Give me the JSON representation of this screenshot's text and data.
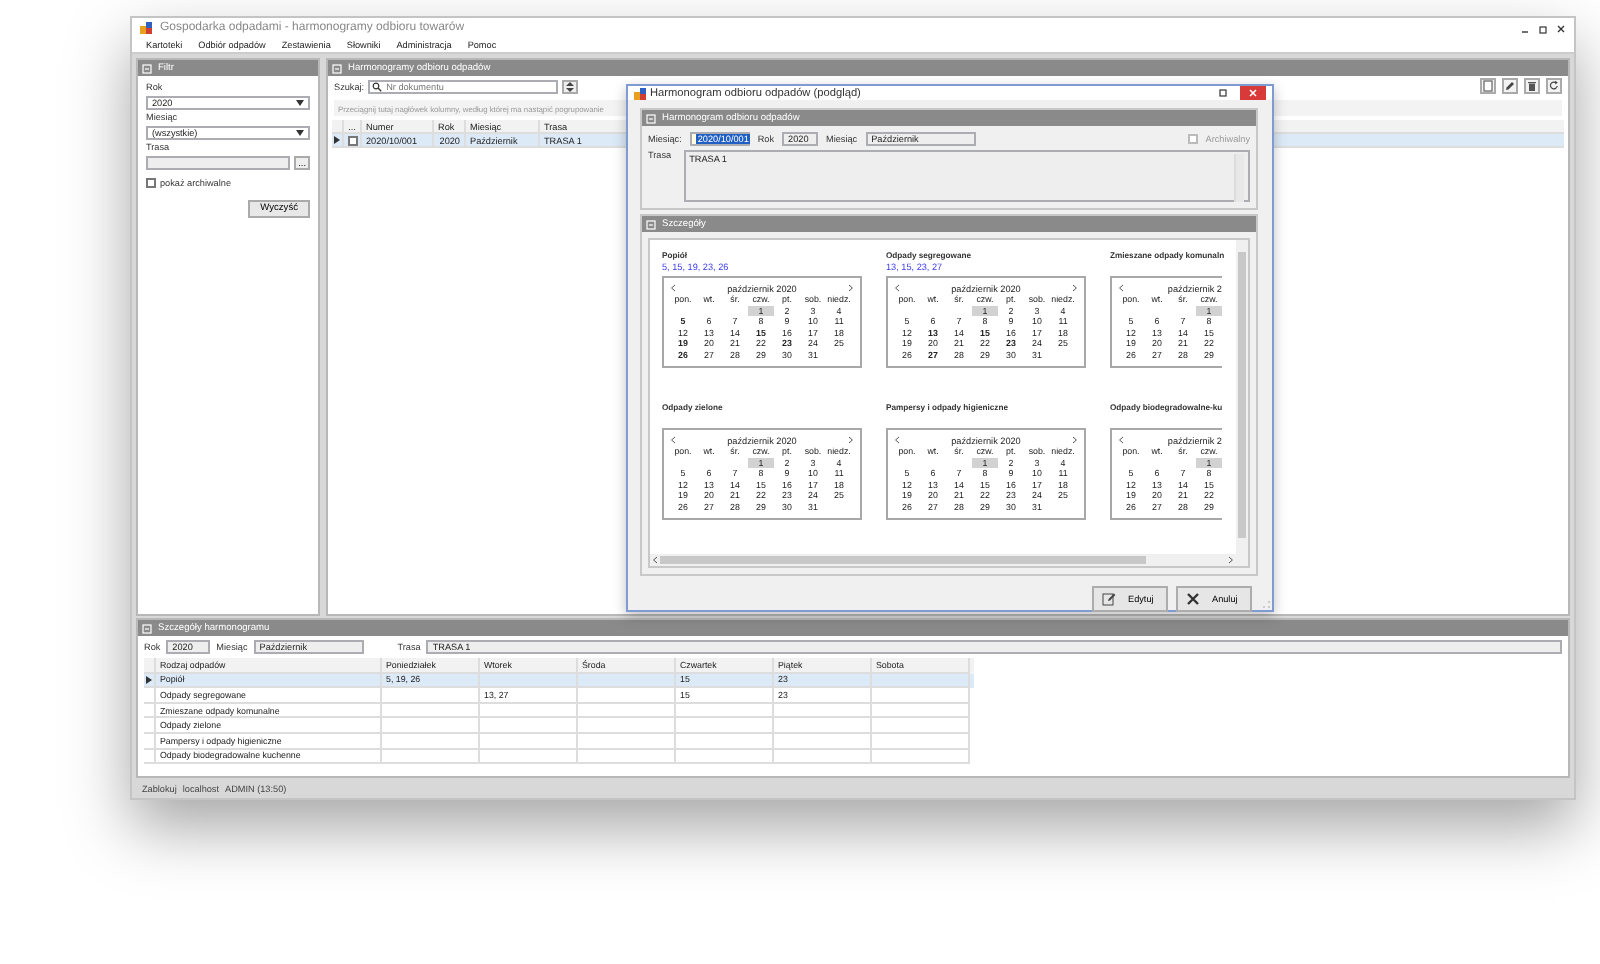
{
  "window": {
    "title": "Gospodarka odpadami - harmonogramy odbioru towarów"
  },
  "menu": [
    "Kartoteki",
    "Odbiór odpadów",
    "Zestawienia",
    "Słowniki",
    "Administracja",
    "Pomoc"
  ],
  "filter": {
    "title": "Filtr",
    "year_label": "Rok",
    "year": "2020",
    "month_label": "Miesiąc",
    "month": "(wszystkie)",
    "route_label": "Trasa",
    "route_button": "...",
    "show_archived": {
      "label": "pokaż archiwalne",
      "checked": false
    },
    "clear_button": "Wyczyść"
  },
  "schedules": {
    "title": "Harmonogramy odbioru odpadów",
    "search_label": "Szukaj:",
    "search_placeholder": "Nr dokumentu",
    "group_hint": "Przeciągnij tutaj nagłówek kolumny, według której ma nastąpić pogrupowanie",
    "select_header": "...",
    "columns": [
      "Numer",
      "Rok",
      "Miesiąc",
      "Trasa"
    ],
    "rows": [
      {
        "selected": true,
        "checked": false,
        "cells": [
          "2020/10/001",
          "2020",
          "Październik",
          "TRASA 1"
        ]
      }
    ]
  },
  "details": {
    "title": "Szczegóły harmonogramu",
    "year_label": "Rok",
    "year": "2020",
    "month_label": "Miesiąc",
    "month": "Październik",
    "route_label": "Trasa",
    "route": "TRASA 1",
    "columns": [
      "Rodzaj odpadów",
      "Poniedziałek",
      "Wtorek",
      "Środa",
      "Czwartek",
      "Piątek",
      "Sobota"
    ],
    "rows": [
      {
        "selected": true,
        "cells": [
          "Popiół",
          "5, 19, 26",
          null,
          null,
          "15",
          "23",
          null
        ]
      },
      {
        "selected": false,
        "cells": [
          "Odpady segregowane",
          null,
          "13, 27",
          null,
          "15",
          "23",
          null
        ]
      },
      {
        "selected": false,
        "cells": [
          "Zmieszane odpady komunalne",
          null,
          null,
          null,
          null,
          null,
          null
        ]
      },
      {
        "selected": false,
        "cells": [
          "Odpady zielone",
          null,
          null,
          null,
          null,
          null,
          null
        ]
      },
      {
        "selected": false,
        "cells": [
          "Pampersy i odpady higieniczne",
          null,
          null,
          null,
          null,
          null,
          null
        ]
      },
      {
        "selected": false,
        "cells": [
          "Odpady biodegradowalne kuchenne",
          null,
          null,
          null,
          null,
          null,
          null
        ]
      }
    ]
  },
  "status_bar": [
    "Zablokuj",
    "localhost",
    "ADMIN (13:50)"
  ],
  "dialog": {
    "title": "Harmonogram odbioru odpadów (podgląd)",
    "header_section": "Harmonogram odbioru odpadów",
    "number": {
      "label": "Miesiąc:",
      "value": "2020/10/001",
      "focused": true
    },
    "year": {
      "label": "Rok",
      "value": "2020",
      "focused": false
    },
    "month": {
      "label": "Miesiąc",
      "value": "Październik",
      "focused": false
    },
    "archived": {
      "label": "Archiwalny",
      "checked": false
    },
    "route_label": "Trasa",
    "route": "TRASA 1",
    "details_section": "Szczegóły",
    "groups": [
      {
        "kind": "full",
        "name": "Popiół",
        "dates": "5, 15, 19, 23, 26",
        "month": "październik 2020",
        "weekdays": [
          "pon.",
          "wt.",
          "śr.",
          "czw.",
          "pt.",
          "sob.",
          "niedz."
        ],
        "weeks": [
          [
            {
              "d": "1",
              "bold": false,
              "today": true
            },
            {
              "d": "2",
              "bold": false,
              "today": false
            },
            {
              "d": "3",
              "bold": false,
              "today": false
            },
            {
              "d": "4",
              "bold": false,
              "today": false
            }
          ],
          [
            {
              "d": "5",
              "bold": true,
              "today": false
            },
            {
              "d": "6",
              "bold": false,
              "today": false
            },
            {
              "d": "7",
              "bold": false,
              "today": false
            },
            {
              "d": "8",
              "bold": false,
              "today": false
            },
            {
              "d": "9",
              "bold": false,
              "today": false
            },
            {
              "d": "10",
              "bold": false,
              "today": false
            },
            {
              "d": "11",
              "bold": false,
              "today": false
            }
          ],
          [
            {
              "d": "12",
              "bold": false,
              "today": false
            },
            {
              "d": "13",
              "bold": false,
              "today": false
            },
            {
              "d": "14",
              "bold": false,
              "today": false
            },
            {
              "d": "15",
              "bold": true,
              "today": false
            },
            {
              "d": "16",
              "bold": false,
              "today": false
            },
            {
              "d": "17",
              "bold": false,
              "today": false
            },
            {
              "d": "18",
              "bold": false,
              "today": false
            }
          ],
          [
            {
              "d": "19",
              "bold": true,
              "today": false
            },
            {
              "d": "20",
              "bold": false,
              "today": false
            },
            {
              "d": "21",
              "bold": false,
              "today": false
            },
            {
              "d": "22",
              "bold": false,
              "today": false
            },
            {
              "d": "23",
              "bold": true,
              "today": false
            },
            {
              "d": "24",
              "bold": false,
              "today": false
            },
            {
              "d": "25",
              "bold": false,
              "today": false
            }
          ],
          [
            {
              "d": "26",
              "bold": true,
              "today": false
            },
            {
              "d": "27",
              "bold": false,
              "today": false
            },
            {
              "d": "28",
              "bold": false,
              "today": false
            },
            {
              "d": "29",
              "bold": false,
              "today": false
            },
            {
              "d": "30",
              "bold": false,
              "today": false
            },
            {
              "d": "31",
              "bold": false,
              "today": false
            }
          ]
        ]
      },
      {
        "kind": "full",
        "name": "Odpady segregowane",
        "dates": "13, 15, 23, 27",
        "month": "październik 2020",
        "weekdays": [
          "pon.",
          "wt.",
          "śr.",
          "czw.",
          "pt.",
          "sob.",
          "niedz."
        ],
        "weeks": [
          [
            {
              "d": "1",
              "bold": false,
              "today": true
            },
            {
              "d": "2",
              "bold": false,
              "today": false
            },
            {
              "d": "3",
              "bold": false,
              "today": false
            },
            {
              "d": "4",
              "bold": false,
              "today": false
            }
          ],
          [
            {
              "d": "5",
              "bold": false,
              "today": false
            },
            {
              "d": "6",
              "bold": false,
              "today": false
            },
            {
              "d": "7",
              "bold": false,
              "today": false
            },
            {
              "d": "8",
              "bold": false,
              "today": false
            },
            {
              "d": "9",
              "bold": false,
              "today": false
            },
            {
              "d": "10",
              "bold": false,
              "today": false
            },
            {
              "d": "11",
              "bold": false,
              "today": false
            }
          ],
          [
            {
              "d": "12",
              "bold": false,
              "today": false
            },
            {
              "d": "13",
              "bold": true,
              "today": false
            },
            {
              "d": "14",
              "bold": false,
              "today": false
            },
            {
              "d": "15",
              "bold": true,
              "today": false
            },
            {
              "d": "16",
              "bold": false,
              "today": false
            },
            {
              "d": "17",
              "bold": false,
              "today": false
            },
            {
              "d": "18",
              "bold": false,
              "today": false
            }
          ],
          [
            {
              "d": "19",
              "bold": false,
              "today": false
            },
            {
              "d": "20",
              "bold": false,
              "today": false
            },
            {
              "d": "21",
              "bold": false,
              "today": false
            },
            {
              "d": "22",
              "bold": false,
              "today": false
            },
            {
              "d": "23",
              "bold": true,
              "today": false
            },
            {
              "d": "24",
              "bold": false,
              "today": false
            },
            {
              "d": "25",
              "bold": false,
              "today": false
            }
          ],
          [
            {
              "d": "26",
              "bold": false,
              "today": false
            },
            {
              "d": "27",
              "bold": true,
              "today": false
            },
            {
              "d": "28",
              "bold": false,
              "today": false
            },
            {
              "d": "29",
              "bold": false,
              "today": false
            },
            {
              "d": "30",
              "bold": false,
              "today": false
            },
            {
              "d": "31",
              "bold": false,
              "today": false
            }
          ]
        ]
      },
      {
        "kind": "clipped",
        "name": "Zmieszane odpady komunaln",
        "month": "październik 2",
        "weekdays": [
          "pon.",
          "wt.",
          "śr.",
          "czw."
        ],
        "weeks": [
          [
            {
              "d": "1",
              "bold": false,
              "today": true
            }
          ],
          [
            {
              "d": "5",
              "bold": false,
              "today": false
            },
            {
              "d": "6",
              "bold": false,
              "today": false
            },
            {
              "d": "7",
              "bold": false,
              "today": false
            },
            {
              "d": "8",
              "bold": false,
              "today": false
            }
          ],
          [
            {
              "d": "12",
              "bold": false,
              "today": false
            },
            {
              "d": "13",
              "bold": false,
              "today": false
            },
            {
              "d": "14",
              "bold": false,
              "today": false
            },
            {
              "d": "15",
              "bold": false,
              "today": false
            }
          ],
          [
            {
              "d": "19",
              "bold": false,
              "today": false
            },
            {
              "d": "20",
              "bold": false,
              "today": false
            },
            {
              "d": "21",
              "bold": false,
              "today": false
            },
            {
              "d": "22",
              "bold": false,
              "today": false
            }
          ],
          [
            {
              "d": "26",
              "bold": false,
              "today": false
            },
            {
              "d": "27",
              "bold": false,
              "today": false
            },
            {
              "d": "28",
              "bold": false,
              "today": false
            },
            {
              "d": "29",
              "bold": false,
              "today": false
            }
          ]
        ]
      },
      {
        "kind": "full",
        "name": "Odpady zielone",
        "month": "październik 2020",
        "weekdays": [
          "pon.",
          "wt.",
          "śr.",
          "czw.",
          "pt.",
          "sob.",
          "niedz."
        ],
        "weeks": [
          [
            {
              "d": "1",
              "bold": false,
              "today": true
            },
            {
              "d": "2",
              "bold": false,
              "today": false
            },
            {
              "d": "3",
              "bold": false,
              "today": false
            },
            {
              "d": "4",
              "bold": false,
              "today": false
            }
          ],
          [
            {
              "d": "5",
              "bold": false,
              "today": false
            },
            {
              "d": "6",
              "bold": false,
              "today": false
            },
            {
              "d": "7",
              "bold": false,
              "today": false
            },
            {
              "d": "8",
              "bold": false,
              "today": false
            },
            {
              "d": "9",
              "bold": false,
              "today": false
            },
            {
              "d": "10",
              "bold": false,
              "today": false
            },
            {
              "d": "11",
              "bold": false,
              "today": false
            }
          ],
          [
            {
              "d": "12",
              "bold": false,
              "today": false
            },
            {
              "d": "13",
              "bold": false,
              "today": false
            },
            {
              "d": "14",
              "bold": false,
              "today": false
            },
            {
              "d": "15",
              "bold": false,
              "today": false
            },
            {
              "d": "16",
              "bold": false,
              "today": false
            },
            {
              "d": "17",
              "bold": false,
              "today": false
            },
            {
              "d": "18",
              "bold": false,
              "today": false
            }
          ],
          [
            {
              "d": "19",
              "bold": false,
              "today": false
            },
            {
              "d": "20",
              "bold": false,
              "today": false
            },
            {
              "d": "21",
              "bold": false,
              "today": false
            },
            {
              "d": "22",
              "bold": false,
              "today": false
            },
            {
              "d": "23",
              "bold": false,
              "today": false
            },
            {
              "d": "24",
              "bold": false,
              "today": false
            },
            {
              "d": "25",
              "bold": false,
              "today": false
            }
          ],
          [
            {
              "d": "26",
              "bold": false,
              "today": false
            },
            {
              "d": "27",
              "bold": false,
              "today": false
            },
            {
              "d": "28",
              "bold": false,
              "today": false
            },
            {
              "d": "29",
              "bold": false,
              "today": false
            },
            {
              "d": "30",
              "bold": false,
              "today": false
            },
            {
              "d": "31",
              "bold": false,
              "today": false
            }
          ]
        ]
      },
      {
        "kind": "full",
        "name": "Pampersy i odpady higieniczne",
        "month": "październik 2020",
        "weekdays": [
          "pon.",
          "wt.",
          "śr.",
          "czw.",
          "pt.",
          "sob.",
          "niedz."
        ],
        "weeks": [
          [
            {
              "d": "1",
              "bold": false,
              "today": true
            },
            {
              "d": "2",
              "bold": false,
              "today": false
            },
            {
              "d": "3",
              "bold": false,
              "today": false
            },
            {
              "d": "4",
              "bold": false,
              "today": false
            }
          ],
          [
            {
              "d": "5",
              "bold": false,
              "today": false
            },
            {
              "d": "6",
              "bold": false,
              "today": false
            },
            {
              "d": "7",
              "bold": false,
              "today": false
            },
            {
              "d": "8",
              "bold": false,
              "today": false
            },
            {
              "d": "9",
              "bold": false,
              "today": false
            },
            {
              "d": "10",
              "bold": false,
              "today": false
            },
            {
              "d": "11",
              "bold": false,
              "today": false
            }
          ],
          [
            {
              "d": "12",
              "bold": false,
              "today": false
            },
            {
              "d": "13",
              "bold": false,
              "today": false
            },
            {
              "d": "14",
              "bold": false,
              "today": false
            },
            {
              "d": "15",
              "bold": false,
              "today": false
            },
            {
              "d": "16",
              "bold": false,
              "today": false
            },
            {
              "d": "17",
              "bold": false,
              "today": false
            },
            {
              "d": "18",
              "bold": false,
              "today": false
            }
          ],
          [
            {
              "d": "19",
              "bold": false,
              "today": false
            },
            {
              "d": "20",
              "bold": false,
              "today": false
            },
            {
              "d": "21",
              "bold": false,
              "today": false
            },
            {
              "d": "22",
              "bold": false,
              "today": false
            },
            {
              "d": "23",
              "bold": false,
              "today": false
            },
            {
              "d": "24",
              "bold": false,
              "today": false
            },
            {
              "d": "25",
              "bold": false,
              "today": false
            }
          ],
          [
            {
              "d": "26",
              "bold": false,
              "today": false
            },
            {
              "d": "27",
              "bold": false,
              "today": false
            },
            {
              "d": "28",
              "bold": false,
              "today": false
            },
            {
              "d": "29",
              "bold": false,
              "today": false
            },
            {
              "d": "30",
              "bold": false,
              "today": false
            },
            {
              "d": "31",
              "bold": false,
              "today": false
            }
          ]
        ]
      },
      {
        "kind": "clipped",
        "name": "Odpady biodegradowalne-ku",
        "month": "październik 2",
        "weekdays": [
          "pon.",
          "wt.",
          "śr.",
          "czw."
        ],
        "weeks": [
          [
            {
              "d": "1",
              "bold": false,
              "today": true
            }
          ],
          [
            {
              "d": "5",
              "bold": false,
              "today": false
            },
            {
              "d": "6",
              "bold": false,
              "today": false
            },
            {
              "d": "7",
              "bold": false,
              "today": false
            },
            {
              "d": "8",
              "bold": false,
              "today": false
            }
          ],
          [
            {
              "d": "12",
              "bold": false,
              "today": false
            },
            {
              "d": "13",
              "bold": false,
              "today": false
            },
            {
              "d": "14",
              "bold": false,
              "today": false
            },
            {
              "d": "15",
              "bold": false,
              "today": false
            }
          ],
          [
            {
              "d": "19",
              "bold": false,
              "today": false
            },
            {
              "d": "20",
              "bold": false,
              "today": false
            },
            {
              "d": "21",
              "bold": false,
              "today": false
            },
            {
              "d": "22",
              "bold": false,
              "today": false
            }
          ],
          [
            {
              "d": "26",
              "bold": false,
              "today": false
            },
            {
              "d": "27",
              "bold": false,
              "today": false
            },
            {
              "d": "28",
              "bold": false,
              "today": false
            },
            {
              "d": "29",
              "bold": false,
              "today": false
            }
          ]
        ]
      }
    ],
    "buttons": [
      {
        "kind": "edit",
        "label": "Edytuj"
      },
      {
        "kind": "cancel",
        "label": "Anuluj"
      }
    ]
  }
}
